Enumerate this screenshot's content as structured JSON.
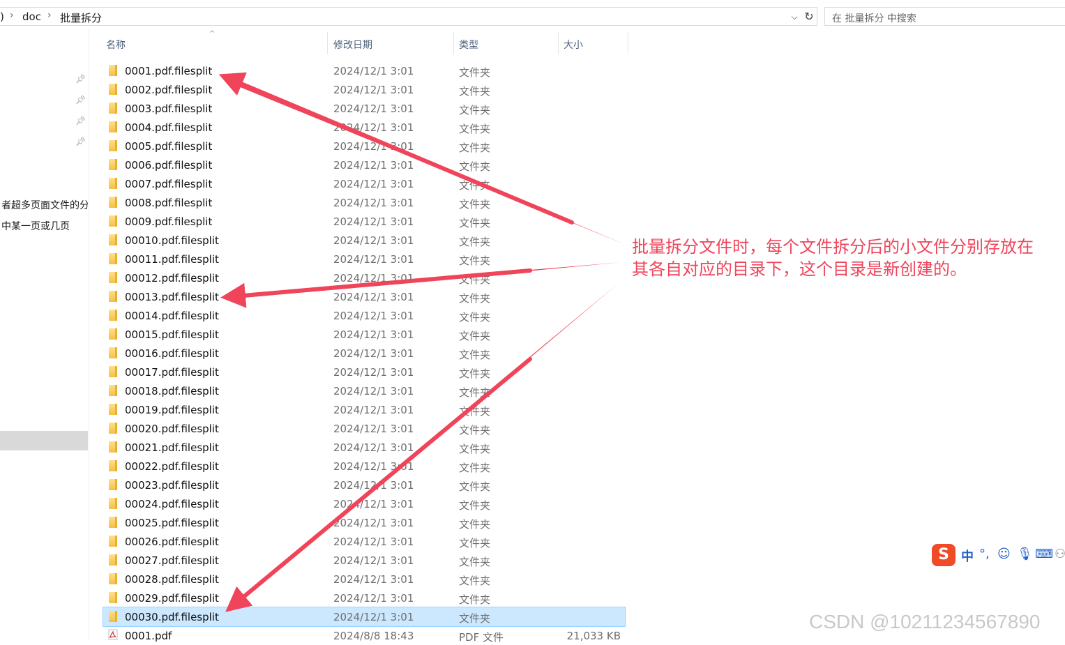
{
  "address": {
    "crumbs": [
      ")",
      "doc",
      "批量拆分"
    ],
    "dropdown_icon": "chevron-down-icon",
    "refresh_icon": "refresh-icon"
  },
  "search": {
    "placeholder": "在 批量拆分 中搜索"
  },
  "nav": {
    "lines": [
      "者超多页面文件的分",
      "中某一页或几页"
    ]
  },
  "columns": {
    "name": "名称",
    "date": "修改日期",
    "type": "类型",
    "size": "大小"
  },
  "files": [
    {
      "name": "0001.pdf.filesplit",
      "date": "2024/12/1 3:01",
      "type": "文件夹",
      "size": "",
      "kind": "folder"
    },
    {
      "name": "0002.pdf.filesplit",
      "date": "2024/12/1 3:01",
      "type": "文件夹",
      "size": "",
      "kind": "folder"
    },
    {
      "name": "0003.pdf.filesplit",
      "date": "2024/12/1 3:01",
      "type": "文件夹",
      "size": "",
      "kind": "folder"
    },
    {
      "name": "0004.pdf.filesplit",
      "date": "2024/12/1 3:01",
      "type": "文件夹",
      "size": "",
      "kind": "folder"
    },
    {
      "name": "0005.pdf.filesplit",
      "date": "2024/12/1 3:01",
      "type": "文件夹",
      "size": "",
      "kind": "folder"
    },
    {
      "name": "0006.pdf.filesplit",
      "date": "2024/12/1 3:01",
      "type": "文件夹",
      "size": "",
      "kind": "folder"
    },
    {
      "name": "0007.pdf.filesplit",
      "date": "2024/12/1 3:01",
      "type": "文件夹",
      "size": "",
      "kind": "folder"
    },
    {
      "name": "0008.pdf.filesplit",
      "date": "2024/12/1 3:01",
      "type": "文件夹",
      "size": "",
      "kind": "folder"
    },
    {
      "name": "0009.pdf.filesplit",
      "date": "2024/12/1 3:01",
      "type": "文件夹",
      "size": "",
      "kind": "folder"
    },
    {
      "name": "00010.pdf.filesplit",
      "date": "2024/12/1 3:01",
      "type": "文件夹",
      "size": "",
      "kind": "folder"
    },
    {
      "name": "00011.pdf.filesplit",
      "date": "2024/12/1 3:01",
      "type": "文件夹",
      "size": "",
      "kind": "folder"
    },
    {
      "name": "00012.pdf.filesplit",
      "date": "2024/12/1 3:01",
      "type": "文件夹",
      "size": "",
      "kind": "folder"
    },
    {
      "name": "00013.pdf.filesplit",
      "date": "2024/12/1 3:01",
      "type": "文件夹",
      "size": "",
      "kind": "folder"
    },
    {
      "name": "00014.pdf.filesplit",
      "date": "2024/12/1 3:01",
      "type": "文件夹",
      "size": "",
      "kind": "folder"
    },
    {
      "name": "00015.pdf.filesplit",
      "date": "2024/12/1 3:01",
      "type": "文件夹",
      "size": "",
      "kind": "folder"
    },
    {
      "name": "00016.pdf.filesplit",
      "date": "2024/12/1 3:01",
      "type": "文件夹",
      "size": "",
      "kind": "folder"
    },
    {
      "name": "00017.pdf.filesplit",
      "date": "2024/12/1 3:01",
      "type": "文件夹",
      "size": "",
      "kind": "folder"
    },
    {
      "name": "00018.pdf.filesplit",
      "date": "2024/12/1 3:01",
      "type": "文件夹",
      "size": "",
      "kind": "folder"
    },
    {
      "name": "00019.pdf.filesplit",
      "date": "2024/12/1 3:01",
      "type": "文件夹",
      "size": "",
      "kind": "folder"
    },
    {
      "name": "00020.pdf.filesplit",
      "date": "2024/12/1 3:01",
      "type": "文件夹",
      "size": "",
      "kind": "folder"
    },
    {
      "name": "00021.pdf.filesplit",
      "date": "2024/12/1 3:01",
      "type": "文件夹",
      "size": "",
      "kind": "folder"
    },
    {
      "name": "00022.pdf.filesplit",
      "date": "2024/12/1 3:01",
      "type": "文件夹",
      "size": "",
      "kind": "folder"
    },
    {
      "name": "00023.pdf.filesplit",
      "date": "2024/12/1 3:01",
      "type": "文件夹",
      "size": "",
      "kind": "folder"
    },
    {
      "name": "00024.pdf.filesplit",
      "date": "2024/12/1 3:01",
      "type": "文件夹",
      "size": "",
      "kind": "folder"
    },
    {
      "name": "00025.pdf.filesplit",
      "date": "2024/12/1 3:01",
      "type": "文件夹",
      "size": "",
      "kind": "folder"
    },
    {
      "name": "00026.pdf.filesplit",
      "date": "2024/12/1 3:01",
      "type": "文件夹",
      "size": "",
      "kind": "folder"
    },
    {
      "name": "00027.pdf.filesplit",
      "date": "2024/12/1 3:01",
      "type": "文件夹",
      "size": "",
      "kind": "folder"
    },
    {
      "name": "00028.pdf.filesplit",
      "date": "2024/12/1 3:01",
      "type": "文件夹",
      "size": "",
      "kind": "folder"
    },
    {
      "name": "00029.pdf.filesplit",
      "date": "2024/12/1 3:01",
      "type": "文件夹",
      "size": "",
      "kind": "folder"
    },
    {
      "name": "00030.pdf.filesplit",
      "date": "2024/12/1 3:01",
      "type": "文件夹",
      "size": "",
      "kind": "folder",
      "selected": true
    },
    {
      "name": "0001.pdf",
      "date": "2024/8/8 18:43",
      "type": "PDF 文件",
      "size": "21,033 KB",
      "kind": "pdf"
    }
  ],
  "annotation": {
    "line1": "批量拆分文件时，每个文件拆分后的小文件分别存放在",
    "line2": "其各自对应的目录下，这个目录是新创建的。",
    "color": "#f0445a"
  },
  "ime": {
    "logo": "S",
    "mode": "中",
    "punct": "°,",
    "icons": [
      "emoji-icon",
      "microphone-icon",
      "keyboard-icon",
      "user-icon"
    ]
  },
  "watermark": "CSDN @10211234567890"
}
